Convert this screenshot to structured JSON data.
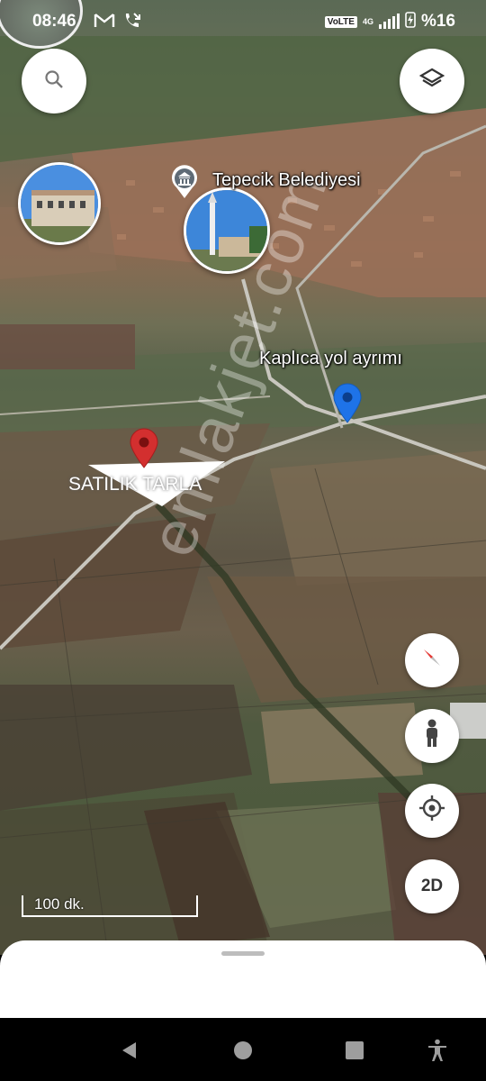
{
  "status_bar": {
    "time": "08:46",
    "network_badge": "VoLTE",
    "network_gen": "4G",
    "battery": "%16",
    "icons": [
      "gmail-icon",
      "missed-call-icon",
      "signal-icon",
      "charging-icon"
    ]
  },
  "map": {
    "poi_label": "Tepecik Belediyesi",
    "road_label": "Kaplıca yol ayrımı",
    "listing_label": "SATILIK TARLA",
    "scale_label": "100 dk.",
    "watermark": "emlakjet.com",
    "pin_colors": {
      "listing": "#d32f2f",
      "road": "#1e73e8"
    }
  },
  "controls": {
    "search_icon": "search-icon",
    "layers_icon": "layers-icon",
    "compass_icon": "compass-icon",
    "street_view_icon": "pegman-icon",
    "location_icon": "my-location-icon",
    "view_mode": "2D"
  },
  "nav_bar": {
    "icons": [
      "back-icon",
      "home-icon",
      "recents-icon",
      "accessibility-icon"
    ]
  }
}
